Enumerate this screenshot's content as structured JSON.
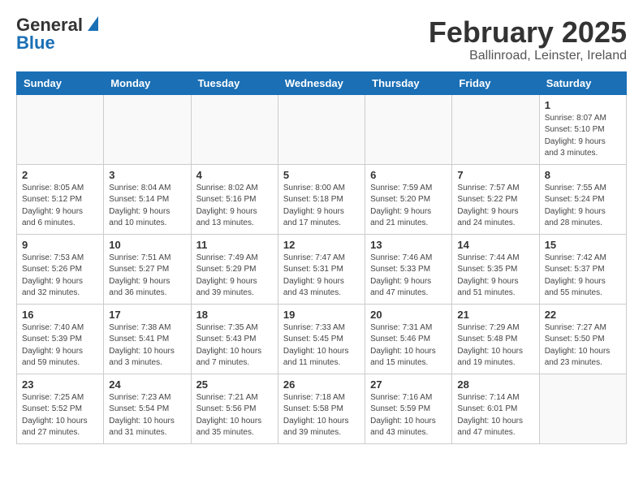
{
  "logo": {
    "general": "General",
    "blue": "Blue"
  },
  "title": "February 2025",
  "subtitle": "Ballinroad, Leinster, Ireland",
  "days_of_week": [
    "Sunday",
    "Monday",
    "Tuesday",
    "Wednesday",
    "Thursday",
    "Friday",
    "Saturday"
  ],
  "weeks": [
    [
      {
        "day": "",
        "info": ""
      },
      {
        "day": "",
        "info": ""
      },
      {
        "day": "",
        "info": ""
      },
      {
        "day": "",
        "info": ""
      },
      {
        "day": "",
        "info": ""
      },
      {
        "day": "",
        "info": ""
      },
      {
        "day": "1",
        "info": "Sunrise: 8:07 AM\nSunset: 5:10 PM\nDaylight: 9 hours and 3 minutes."
      }
    ],
    [
      {
        "day": "2",
        "info": "Sunrise: 8:05 AM\nSunset: 5:12 PM\nDaylight: 9 hours and 6 minutes."
      },
      {
        "day": "3",
        "info": "Sunrise: 8:04 AM\nSunset: 5:14 PM\nDaylight: 9 hours and 10 minutes."
      },
      {
        "day": "4",
        "info": "Sunrise: 8:02 AM\nSunset: 5:16 PM\nDaylight: 9 hours and 13 minutes."
      },
      {
        "day": "5",
        "info": "Sunrise: 8:00 AM\nSunset: 5:18 PM\nDaylight: 9 hours and 17 minutes."
      },
      {
        "day": "6",
        "info": "Sunrise: 7:59 AM\nSunset: 5:20 PM\nDaylight: 9 hours and 21 minutes."
      },
      {
        "day": "7",
        "info": "Sunrise: 7:57 AM\nSunset: 5:22 PM\nDaylight: 9 hours and 24 minutes."
      },
      {
        "day": "8",
        "info": "Sunrise: 7:55 AM\nSunset: 5:24 PM\nDaylight: 9 hours and 28 minutes."
      }
    ],
    [
      {
        "day": "9",
        "info": "Sunrise: 7:53 AM\nSunset: 5:26 PM\nDaylight: 9 hours and 32 minutes."
      },
      {
        "day": "10",
        "info": "Sunrise: 7:51 AM\nSunset: 5:27 PM\nDaylight: 9 hours and 36 minutes."
      },
      {
        "day": "11",
        "info": "Sunrise: 7:49 AM\nSunset: 5:29 PM\nDaylight: 9 hours and 39 minutes."
      },
      {
        "day": "12",
        "info": "Sunrise: 7:47 AM\nSunset: 5:31 PM\nDaylight: 9 hours and 43 minutes."
      },
      {
        "day": "13",
        "info": "Sunrise: 7:46 AM\nSunset: 5:33 PM\nDaylight: 9 hours and 47 minutes."
      },
      {
        "day": "14",
        "info": "Sunrise: 7:44 AM\nSunset: 5:35 PM\nDaylight: 9 hours and 51 minutes."
      },
      {
        "day": "15",
        "info": "Sunrise: 7:42 AM\nSunset: 5:37 PM\nDaylight: 9 hours and 55 minutes."
      }
    ],
    [
      {
        "day": "16",
        "info": "Sunrise: 7:40 AM\nSunset: 5:39 PM\nDaylight: 9 hours and 59 minutes."
      },
      {
        "day": "17",
        "info": "Sunrise: 7:38 AM\nSunset: 5:41 PM\nDaylight: 10 hours and 3 minutes."
      },
      {
        "day": "18",
        "info": "Sunrise: 7:35 AM\nSunset: 5:43 PM\nDaylight: 10 hours and 7 minutes."
      },
      {
        "day": "19",
        "info": "Sunrise: 7:33 AM\nSunset: 5:45 PM\nDaylight: 10 hours and 11 minutes."
      },
      {
        "day": "20",
        "info": "Sunrise: 7:31 AM\nSunset: 5:46 PM\nDaylight: 10 hours and 15 minutes."
      },
      {
        "day": "21",
        "info": "Sunrise: 7:29 AM\nSunset: 5:48 PM\nDaylight: 10 hours and 19 minutes."
      },
      {
        "day": "22",
        "info": "Sunrise: 7:27 AM\nSunset: 5:50 PM\nDaylight: 10 hours and 23 minutes."
      }
    ],
    [
      {
        "day": "23",
        "info": "Sunrise: 7:25 AM\nSunset: 5:52 PM\nDaylight: 10 hours and 27 minutes."
      },
      {
        "day": "24",
        "info": "Sunrise: 7:23 AM\nSunset: 5:54 PM\nDaylight: 10 hours and 31 minutes."
      },
      {
        "day": "25",
        "info": "Sunrise: 7:21 AM\nSunset: 5:56 PM\nDaylight: 10 hours and 35 minutes."
      },
      {
        "day": "26",
        "info": "Sunrise: 7:18 AM\nSunset: 5:58 PM\nDaylight: 10 hours and 39 minutes."
      },
      {
        "day": "27",
        "info": "Sunrise: 7:16 AM\nSunset: 5:59 PM\nDaylight: 10 hours and 43 minutes."
      },
      {
        "day": "28",
        "info": "Sunrise: 7:14 AM\nSunset: 6:01 PM\nDaylight: 10 hours and 47 minutes."
      },
      {
        "day": "",
        "info": ""
      }
    ]
  ]
}
